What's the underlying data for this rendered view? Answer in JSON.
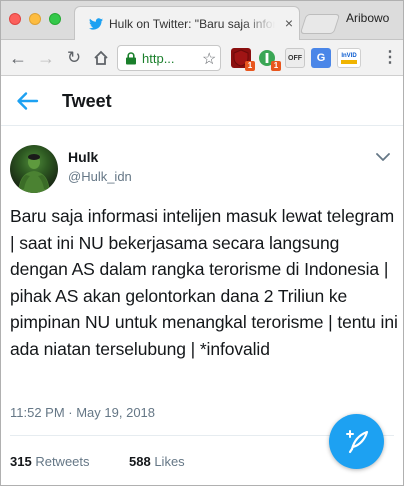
{
  "browser": {
    "tab_title": "Hulk on Twitter: \"Baru saja informasi intelijen",
    "tab_close_glyph": "×",
    "profile_name": "Aribowo",
    "url": "http",
    "url_suffix": "...",
    "extensions": [
      {
        "icon": "ublock-icon",
        "badge": "1"
      },
      {
        "icon": "ghostery-icon",
        "badge": "1"
      },
      {
        "icon": "pdf-icon",
        "label": "OFF"
      },
      {
        "icon": "translate-icon",
        "label": "G"
      },
      {
        "icon": "invid-icon",
        "label": "InVID"
      }
    ]
  },
  "header": {
    "title": "Tweet"
  },
  "tweet": {
    "author_name": "Hulk",
    "author_handle": "@Hulk_idn",
    "text": "Baru saja informasi intelijen masuk lewat telegram | saat ini NU bekerjasama secara langsung dengan AS dalam rangka terorisme di Indonesia | pihak AS akan gelontorkan dana 2 Triliun ke pimpinan NU untuk menangkal terorisme | tentu ini ada niatan terselubung | *infovalid",
    "timestamp": "11:52 PM · May 19, 2018",
    "retweets_count": "315",
    "retweets_label": "Retweets",
    "likes_count": "588",
    "likes_label": "Likes"
  },
  "colors": {
    "twitter_blue": "#1da1f2",
    "secondary_text": "#657786",
    "primary_text": "#14171a",
    "secure_url_green": "#1a7f2b"
  }
}
